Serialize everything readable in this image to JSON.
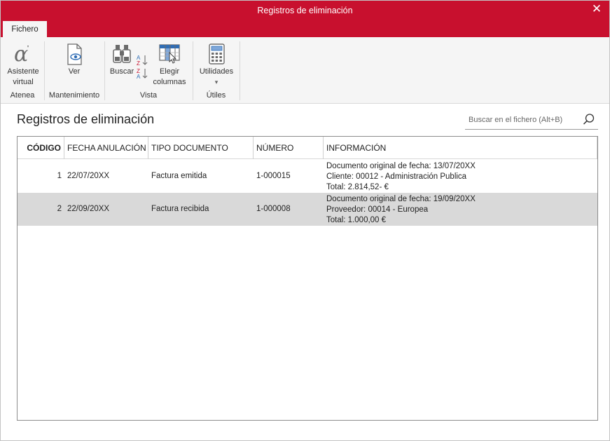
{
  "window": {
    "title": "Registros de eliminación",
    "close_glyph": "✕"
  },
  "ribbon": {
    "tab": "Fichero",
    "groups": [
      {
        "label": "Atenea",
        "buttons": [
          {
            "label_line1": "Asistente",
            "label_line2": "virtual",
            "icon": "alpha-assistant-icon"
          }
        ]
      },
      {
        "label": "Mantenimiento",
        "buttons": [
          {
            "label": "Ver",
            "icon": "view-document-icon"
          }
        ]
      },
      {
        "label": "Vista",
        "buttons": [
          {
            "label": "Buscar",
            "icon": "binoculars-icon"
          },
          {
            "label_line1": "Elegir",
            "label_line2": "columnas",
            "icon": "choose-columns-icon"
          }
        ]
      },
      {
        "label": "Útiles",
        "buttons": [
          {
            "label": "Utilidades",
            "icon": "calculator-icon",
            "dropdown": "▾"
          }
        ]
      }
    ]
  },
  "page": {
    "title": "Registros de eliminación"
  },
  "search": {
    "placeholder": "Buscar en el fichero (Alt+B)"
  },
  "table": {
    "columns": [
      "CÓDIGO",
      "FECHA ANULACIÓN",
      "TIPO DOCUMENTO",
      "NÚMERO",
      "INFORMACIÓN"
    ],
    "rows": [
      {
        "codigo": "1",
        "fecha": "22/07/20XX",
        "tipo": "Factura emitida",
        "numero": "1-000015",
        "info": [
          "Documento original de fecha: 13/07/20XX",
          "Cliente: 00012 - Administración Publica",
          "Total: 2.814,52- €"
        ]
      },
      {
        "codigo": "2",
        "fecha": "22/09/20XX",
        "tipo": "Factura recibida",
        "numero": "1-000008",
        "info": [
          "Documento original de fecha: 19/09/20XX",
          "Proveedor: 00014 - Europea",
          "Total: 1.000,00  €"
        ]
      }
    ]
  },
  "colors": {
    "titlebar": "#c8102e",
    "ribbon": "#f5f5f5",
    "selected_row": "#d9d9d9",
    "icon_blue": "#2f6db5",
    "icon_gray": "#6b6b6b"
  }
}
